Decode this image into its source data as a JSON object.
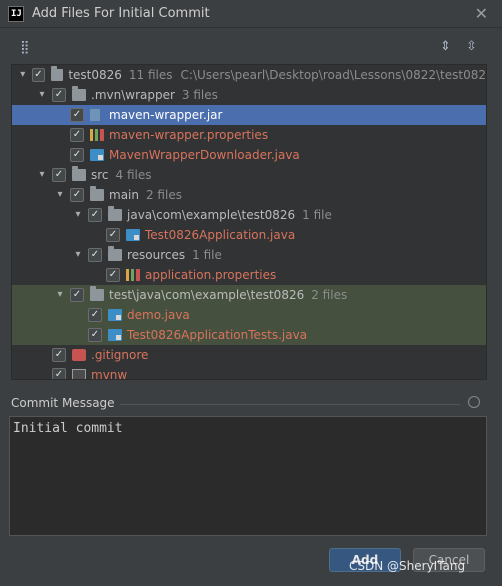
{
  "window": {
    "title": "Add Files For Initial Commit"
  },
  "tree": [
    {
      "indent": 0,
      "chev": "down",
      "icon": "folder",
      "name": "test0826",
      "meta": "11 files",
      "path": "C:\\Users\\pearl\\Desktop\\road\\Lessons\\0822\\test082",
      "style": ""
    },
    {
      "indent": 1,
      "chev": "down",
      "icon": "folder",
      "name": ".mvn\\wrapper",
      "meta": "3 files",
      "path": "",
      "style": ""
    },
    {
      "indent": 2,
      "chev": "",
      "icon": "jar",
      "name": "maven-wrapper.jar",
      "meta": "",
      "path": "",
      "style": "selected"
    },
    {
      "indent": 2,
      "chev": "",
      "icon": "props",
      "name": "maven-wrapper.properties",
      "meta": "",
      "path": "",
      "style": "red"
    },
    {
      "indent": 2,
      "chev": "",
      "icon": "java",
      "name": "MavenWrapperDownloader.java",
      "meta": "",
      "path": "",
      "style": "red"
    },
    {
      "indent": 1,
      "chev": "down",
      "icon": "folder",
      "name": "src",
      "meta": "4 files",
      "path": "",
      "style": ""
    },
    {
      "indent": 2,
      "chev": "down",
      "icon": "folder",
      "name": "main",
      "meta": "2 files",
      "path": "",
      "style": ""
    },
    {
      "indent": 3,
      "chev": "down",
      "icon": "folder",
      "name": "java\\com\\example\\test0826",
      "meta": "1 file",
      "path": "",
      "style": ""
    },
    {
      "indent": 4,
      "chev": "",
      "icon": "java",
      "name": "Test0826Application.java",
      "meta": "",
      "path": "",
      "style": "red"
    },
    {
      "indent": 3,
      "chev": "down",
      "icon": "folder",
      "name": "resources",
      "meta": "1 file",
      "path": "",
      "style": ""
    },
    {
      "indent": 4,
      "chev": "",
      "icon": "props",
      "name": "application.properties",
      "meta": "",
      "path": "",
      "style": "red"
    },
    {
      "indent": 2,
      "chev": "down",
      "icon": "folder",
      "name": "test\\java\\com\\example\\test0826",
      "meta": "2 files",
      "path": "",
      "style": "green"
    },
    {
      "indent": 3,
      "chev": "",
      "icon": "java",
      "name": "demo.java",
      "meta": "",
      "path": "",
      "style": "green-red"
    },
    {
      "indent": 3,
      "chev": "",
      "icon": "java",
      "name": "Test0826ApplicationTests.java",
      "meta": "",
      "path": "",
      "style": "green-red"
    },
    {
      "indent": 1,
      "chev": "",
      "icon": "git",
      "name": ".gitignore",
      "meta": "",
      "path": "",
      "style": "red"
    },
    {
      "indent": 1,
      "chev": "",
      "icon": "exe",
      "name": "mvnw",
      "meta": "",
      "path": "",
      "style": "red"
    }
  ],
  "commit": {
    "label": "Commit Message",
    "value": "Initial commit"
  },
  "buttons": {
    "add": "Add",
    "cancel": "Cancel"
  },
  "watermark": "CSDN @SheryITang",
  "icons": [
    "app-logo-icon",
    "close-icon",
    "group-by-icon",
    "expand-all-icon",
    "collapse-all-icon",
    "history-icon"
  ],
  "colors": {
    "selection": "#4b6eaf",
    "unversioned": "#d9735c",
    "highlight_row": "#45503f",
    "primary_button": "#365880"
  }
}
